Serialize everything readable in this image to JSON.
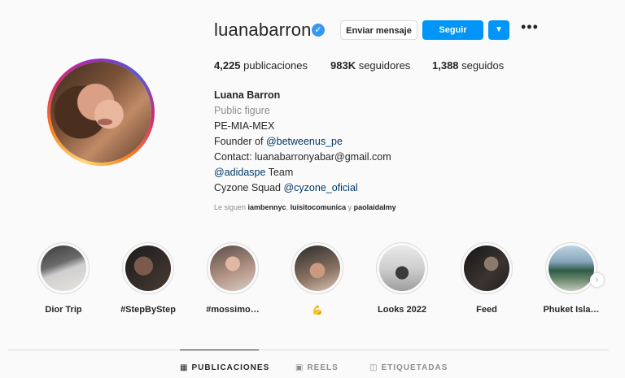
{
  "profile": {
    "username": "luanabarron",
    "verified_icon": "verified-badge-icon",
    "buttons": {
      "message": "Enviar mensaje",
      "follow": "Seguir",
      "dropdown_icon": "chevron-down-icon",
      "more_icon": "more-icon"
    },
    "stats": {
      "posts_value": "4,225",
      "posts_label": "publicaciones",
      "followers_value": "983K",
      "followers_label": "seguidores",
      "following_value": "1,388",
      "following_label": "seguidos"
    },
    "bio": {
      "name": "Luana Barron",
      "category": "Public figure",
      "line1": "PE-MIA-MEX",
      "line2_prefix": "Founder of ",
      "line2_link": "@betweenus_pe",
      "line3": "Contact: luanabarronyabar@gmail.com",
      "line4_link": "@adidaspe",
      "line4_suffix": " Team",
      "line5_prefix": "Cyzone Squad ",
      "line5_link": "@cyzone_oficial"
    },
    "followed_by": {
      "prefix": "Le siguen ",
      "user1": "iambennyc",
      "sep1": ", ",
      "user2": "luisitocomunica",
      "sep2": " y ",
      "user3": "paolaidalmy"
    }
  },
  "highlights": [
    {
      "label": "Dior Trip"
    },
    {
      "label": "#StepByStep"
    },
    {
      "label": "#mossimo…"
    },
    {
      "label": "💪"
    },
    {
      "label": "Looks 2022"
    },
    {
      "label": "Feed"
    },
    {
      "label": "Phuket Isla…"
    }
  ],
  "tabs": [
    {
      "label": "PUBLICACIONES",
      "icon": "grid-icon"
    },
    {
      "label": "REELS",
      "icon": "reels-icon"
    },
    {
      "label": "ETIQUETADAS",
      "icon": "tagged-icon"
    }
  ],
  "colors": {
    "accent": "#0095f6",
    "verified": "#3897f0",
    "link": "#00376b",
    "muted": "#8e8e8e"
  }
}
